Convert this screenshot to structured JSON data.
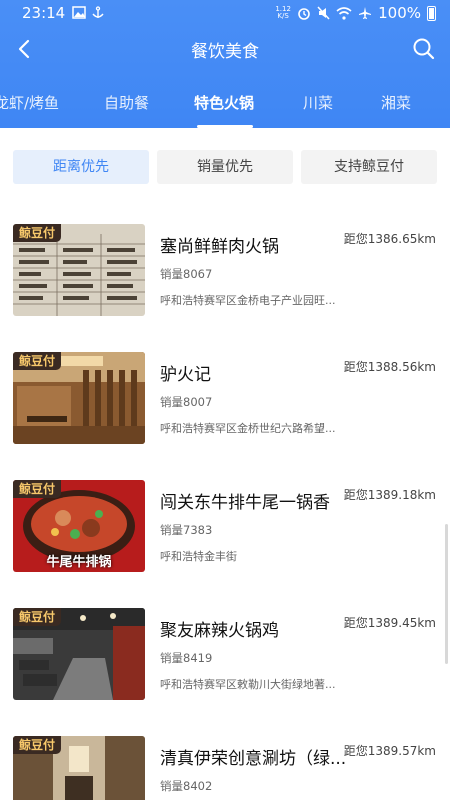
{
  "statusbar": {
    "time": "23:14",
    "netspeed_top": "1.12",
    "netspeed_bottom": "K/S",
    "battery": "100%"
  },
  "navbar": {
    "title": "餐饮美食",
    "back_icon": "chevron-left-icon",
    "search_icon": "search-icon"
  },
  "categories": {
    "items": [
      "龙虾/烤鱼",
      "自助餐",
      "特色火锅",
      "川菜",
      "湘菜"
    ],
    "active": "特色火锅"
  },
  "sort": {
    "options": [
      "距离优先",
      "销量优先",
      "支持鲸豆付"
    ],
    "selected": "距离优先"
  },
  "colors": {
    "header_blue": "#3f86f4",
    "badge_bg": "#3a2a22",
    "badge_text": "#f7c86b"
  },
  "badge_label": "鲸豆付",
  "shops": [
    {
      "name": "塞尚鲜鲜肉火锅",
      "distance": "距您1386.65km",
      "sales": "销量8067",
      "address": "呼和浩特赛罕区金桥电子产业园旺..."
    },
    {
      "name": "驴火记",
      "distance": "距您1388.56km",
      "sales": "销量8007",
      "address": "呼和浩特赛罕区金桥世纪六路希望..."
    },
    {
      "name": "闯关东牛排牛尾一锅香",
      "distance": "距您1389.18km",
      "sales": "销量7383",
      "address": "呼和浩特金丰街",
      "thumb_caption": "牛尾牛排锅"
    },
    {
      "name": "聚友麻辣火锅鸡",
      "distance": "距您1389.45km",
      "sales": "销量8419",
      "address": "呼和浩特赛罕区敕勒川大街绿地著..."
    },
    {
      "name": "清真伊荣创意涮坊（绿...",
      "distance": "距您1389.57km",
      "sales": "销量8402",
      "address": ""
    }
  ]
}
